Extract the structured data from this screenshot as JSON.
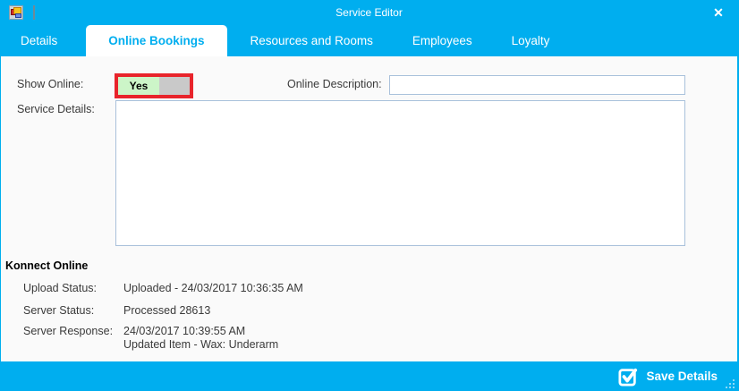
{
  "window": {
    "title": "Service Editor",
    "close_glyph": "✕"
  },
  "tabs": [
    {
      "label": "Details",
      "active": false
    },
    {
      "label": "Online Bookings",
      "active": true
    },
    {
      "label": "Resources and Rooms",
      "active": false
    },
    {
      "label": "Employees",
      "active": false
    },
    {
      "label": "Loyalty",
      "active": false
    }
  ],
  "form": {
    "show_online_label": "Show Online:",
    "show_online_value": "Yes",
    "online_description_label": "Online Description:",
    "online_description_value": "",
    "online_description_placeholder": "",
    "service_details_label": "Service Details:",
    "service_details_value": ""
  },
  "konnect": {
    "heading": "Konnect Online",
    "rows": [
      {
        "label": "Upload Status:",
        "value": "Uploaded - 24/03/2017 10:36:35 AM"
      },
      {
        "label": "Server Status:",
        "value": "Processed 28613"
      },
      {
        "label": "Server Response:",
        "value": "24/03/2017 10:39:55 AM\nUpdated Item - Wax: Underarm"
      }
    ]
  },
  "footer": {
    "save_label": "Save Details"
  },
  "colors": {
    "accent": "#00aeef",
    "annotation_red": "#e8242b",
    "toggle_on_green": "#ccf5c8",
    "toggle_knob_gray": "#c9c9c9",
    "input_border": "#a9c1db",
    "content_background": "#fafafa",
    "label_text": "#3a3a3a"
  }
}
